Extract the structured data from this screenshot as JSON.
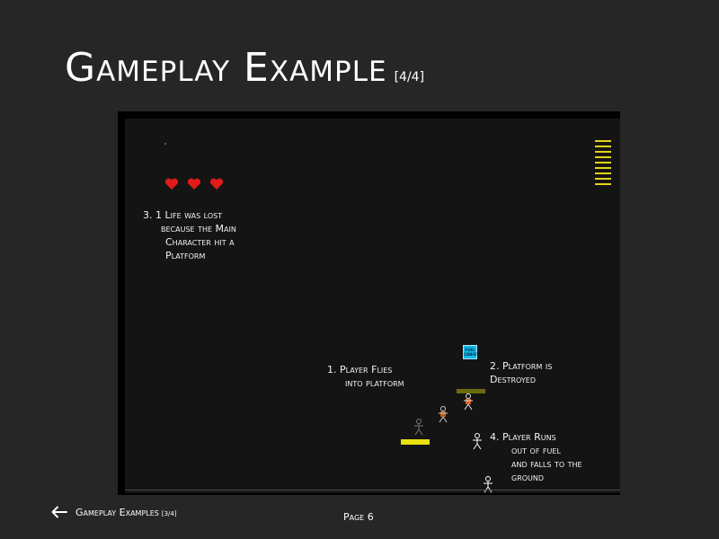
{
  "slide": {
    "title": "Gameplay Example",
    "title_suffix": "[4/4]"
  },
  "game": {
    "lives": 3,
    "fuel_level_bars": 9,
    "fuel_can_label": "FUEL CANIST",
    "colors": {
      "heart": "#e11b1b",
      "fuel_gauge": "#e3d21a",
      "platform": "#e8e10e",
      "fuel_can": "#18b8e8"
    }
  },
  "annotations": {
    "note3": [
      "3.  1 Life was lost",
      "because the Main",
      "Character hit a",
      "Platform"
    ],
    "note1": [
      "1.   Player Flies",
      "into platform"
    ],
    "note2": [
      "2.   Platform is",
      "Destroyed"
    ],
    "note4": [
      "4.   Player Runs",
      "out of fuel",
      "and falls to the",
      "ground"
    ]
  },
  "footer": {
    "back_label": "Gameplay Examples",
    "back_suffix": "[3/4]",
    "page_label": "Page 6",
    "back_icon": "arrow-left-icon"
  }
}
